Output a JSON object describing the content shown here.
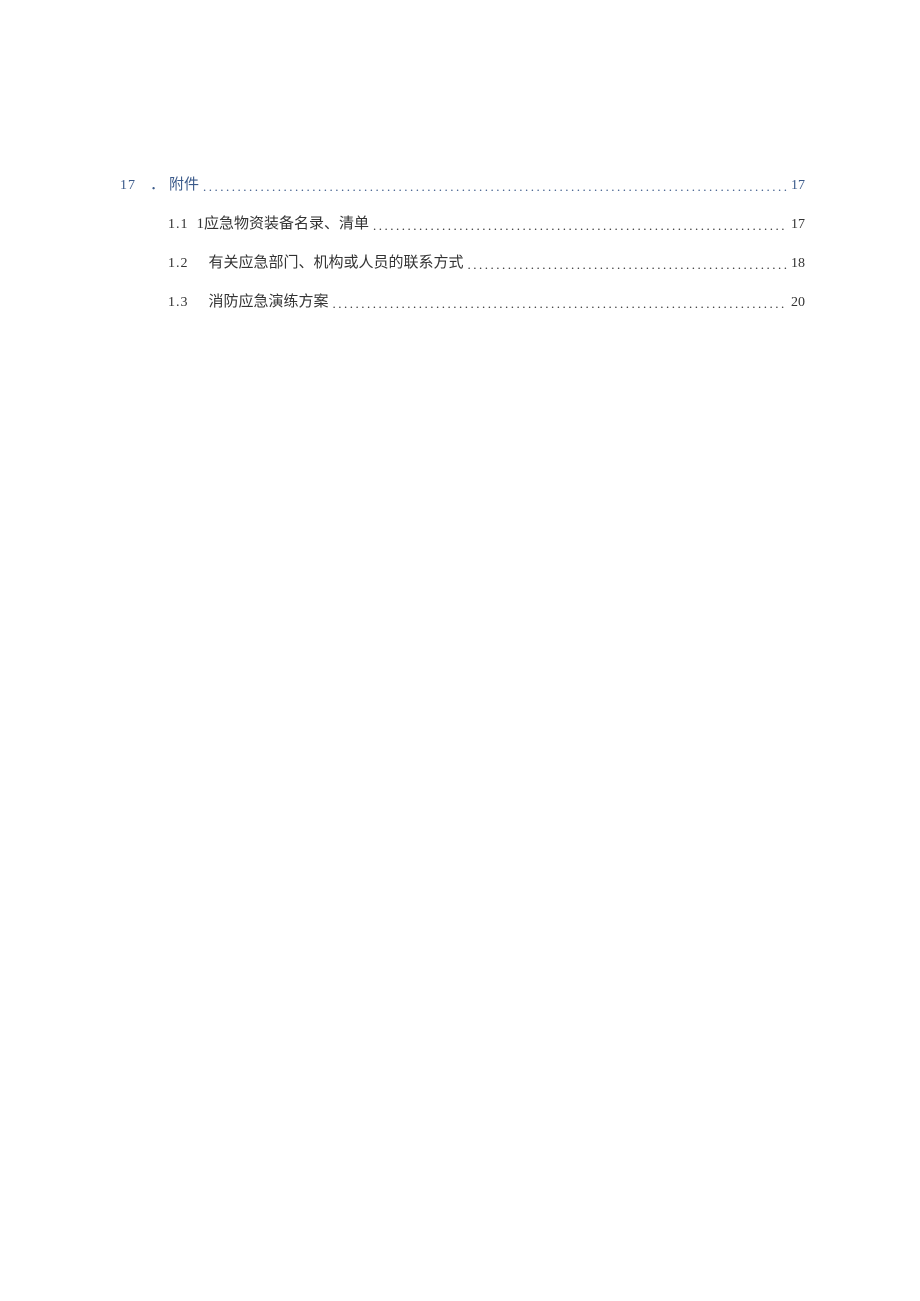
{
  "toc": {
    "main": {
      "number": "17",
      "punct": "．",
      "title": "附件",
      "page": "17"
    },
    "sub": [
      {
        "number": "1.1",
        "prefix": "1",
        "title": "应急物资装备名录、清单",
        "page": "17"
      },
      {
        "number": "1.2",
        "prefix": "",
        "title": "有关应急部门、机构或人员的联系方式",
        "page": "18"
      },
      {
        "number": "1.3",
        "prefix": "",
        "title": "消防应急演练方案",
        "page": "20"
      }
    ]
  }
}
